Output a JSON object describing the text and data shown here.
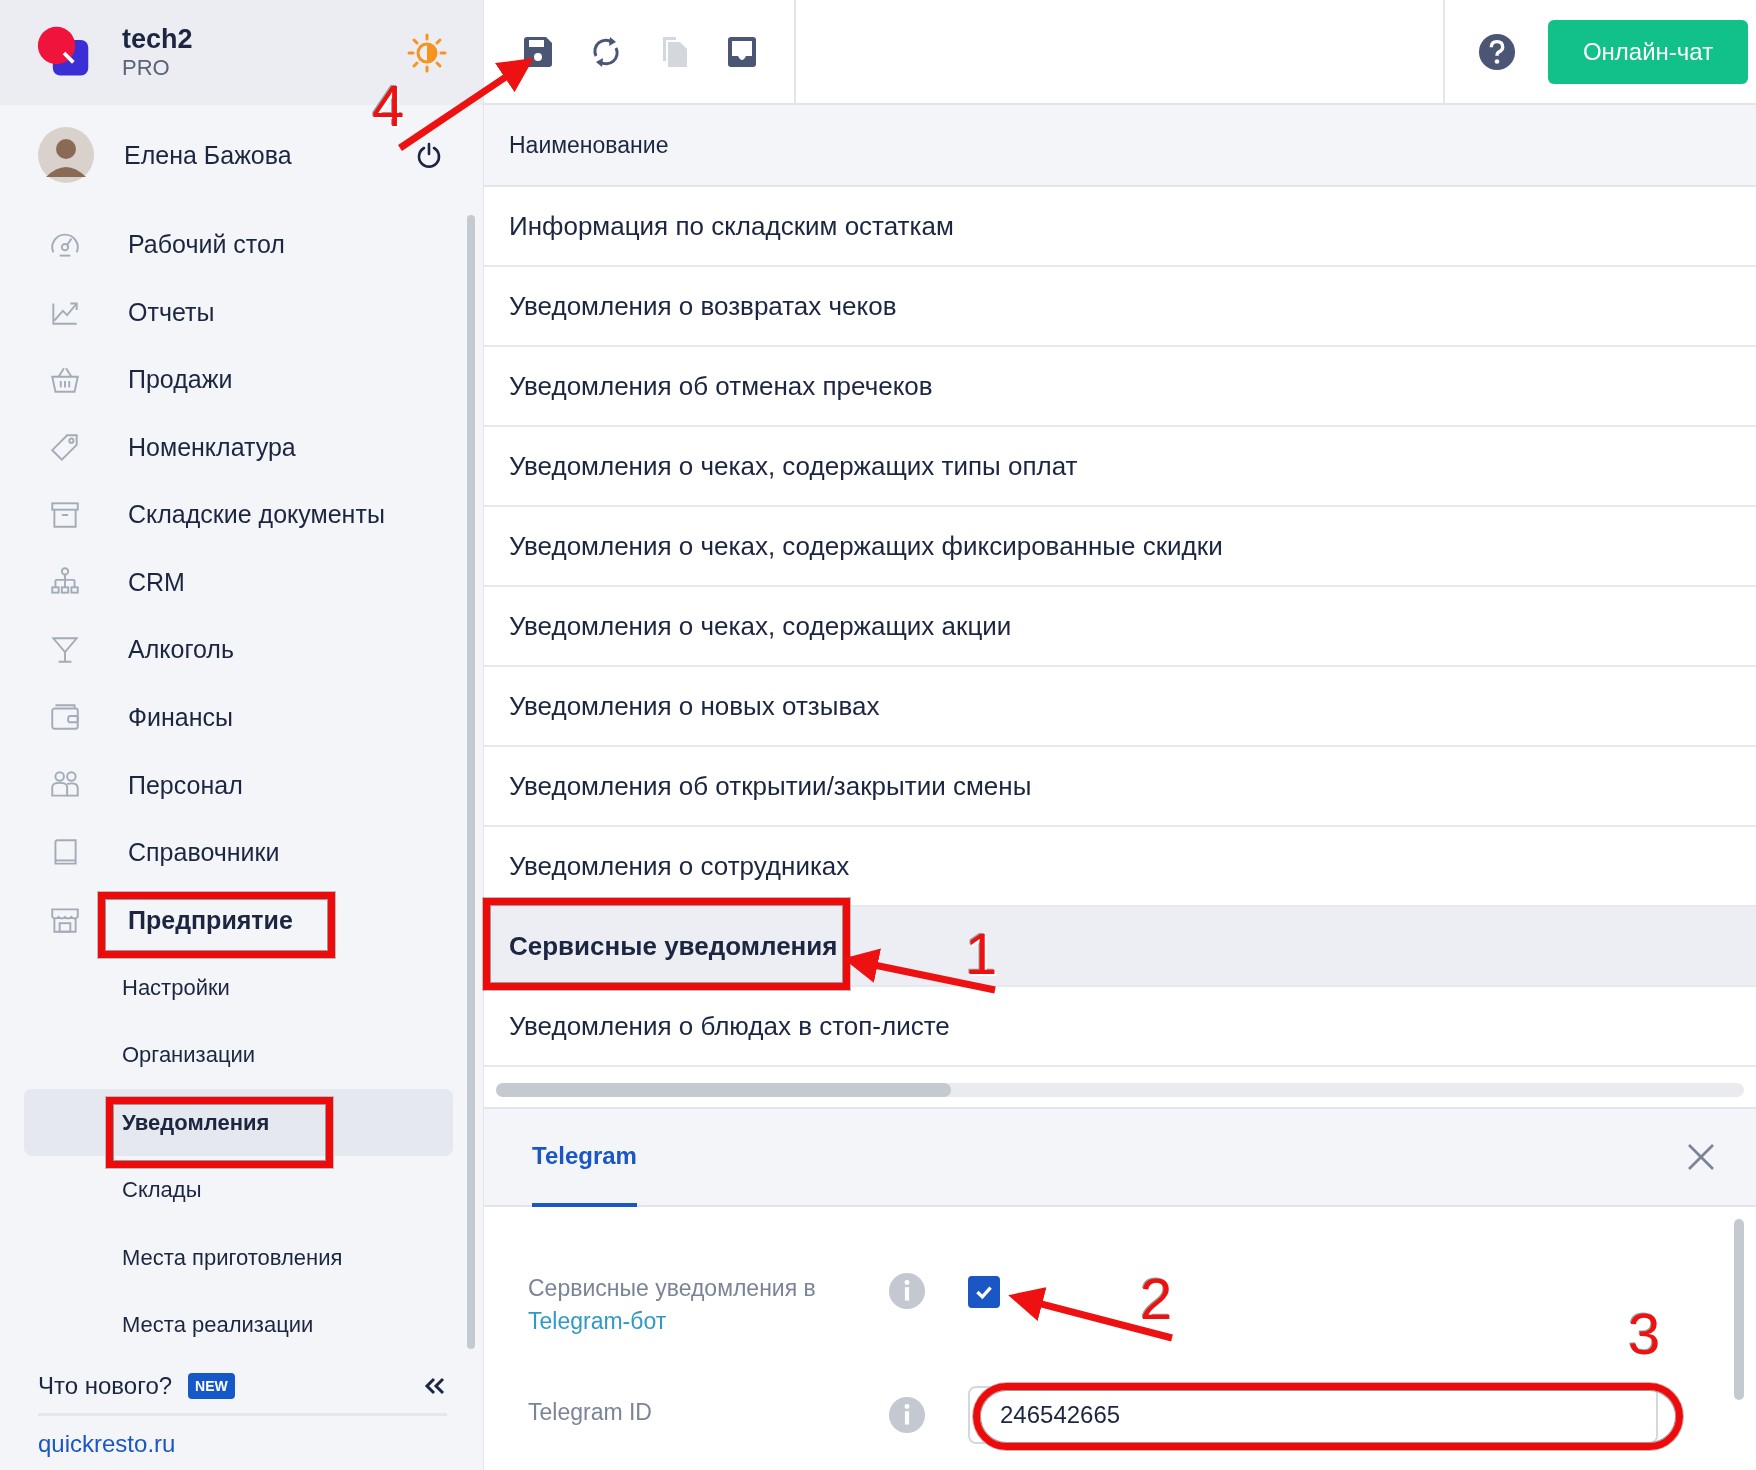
{
  "brand": {
    "name": "tech2",
    "plan": "PRO"
  },
  "user": {
    "name": "Елена Бажова"
  },
  "nav": [
    {
      "label": "Рабочий стол"
    },
    {
      "label": "Отчеты"
    },
    {
      "label": "Продажи"
    },
    {
      "label": "Номенклатура"
    },
    {
      "label": "Складские документы"
    },
    {
      "label": "CRM"
    },
    {
      "label": "Алкоголь"
    },
    {
      "label": "Финансы"
    },
    {
      "label": "Персонал"
    },
    {
      "label": "Справочники"
    },
    {
      "label": "Предприятие",
      "children": [
        {
          "label": "Настройки",
          "selected": false
        },
        {
          "label": "Организации",
          "selected": false
        },
        {
          "label": "Уведомления",
          "selected": true
        },
        {
          "label": "Склады",
          "selected": false
        },
        {
          "label": "Места приготовления",
          "selected": false
        },
        {
          "label": "Места реализации",
          "selected": false
        }
      ]
    }
  ],
  "footer": {
    "whats_new": "Что нового?",
    "badge": "NEW",
    "link": "quickresto.ru"
  },
  "toolbar": [
    {
      "disabled": false
    },
    {
      "disabled": false
    },
    {
      "disabled": true
    },
    {
      "disabled": false
    }
  ],
  "chat_button": "Онлайн-чат",
  "table": {
    "columns": [
      "Наименование"
    ],
    "rows": [
      {
        "name": "Информация по складским остаткам",
        "selected": false
      },
      {
        "name": "Уведомления о возвратах чеков",
        "selected": false
      },
      {
        "name": "Уведомления об отменах пречеков",
        "selected": false
      },
      {
        "name": "Уведомления о чеках, содержащих типы оплат",
        "selected": false
      },
      {
        "name": "Уведомления о чеках, содержащих фиксированные скидки",
        "selected": false
      },
      {
        "name": "Уведомления о чеках, содержащих акции",
        "selected": false
      },
      {
        "name": "Уведомления о новых отзывах",
        "selected": false
      },
      {
        "name": "Уведомления об открытии/закрытии смены",
        "selected": false
      },
      {
        "name": "Уведомления о сотрудниках",
        "selected": false
      },
      {
        "name": "Сервисные уведомления",
        "selected": true
      },
      {
        "name": "Уведомления о блюдах в стоп-листе",
        "selected": false
      }
    ]
  },
  "panel": {
    "tabs": [
      {
        "label": "Telegram",
        "selected": true
      }
    ],
    "fields": [
      {
        "kind": "checkbox",
        "label": "Сервисные уведомления в",
        "link": "Telegram-бот",
        "checked": true
      },
      {
        "kind": "input",
        "label": "Telegram ID",
        "value": "246542665"
      }
    ]
  },
  "annotations": [
    {
      "kind": "number",
      "label": "4"
    },
    {
      "kind": "frame"
    },
    {
      "kind": "frame"
    },
    {
      "kind": "frame"
    },
    {
      "kind": "number",
      "label": "1"
    },
    {
      "kind": "number",
      "label": "2"
    },
    {
      "kind": "frame"
    },
    {
      "kind": "number",
      "label": "3"
    }
  ]
}
